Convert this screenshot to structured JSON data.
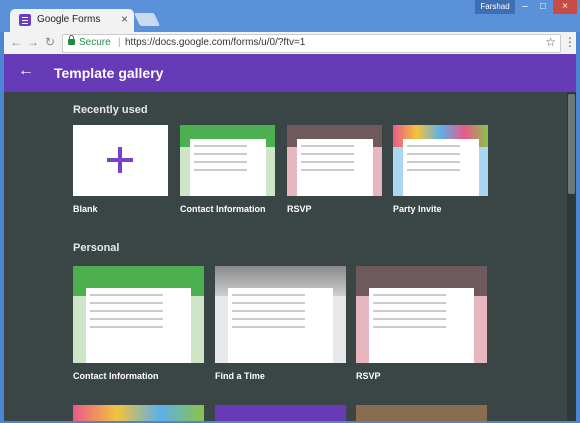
{
  "browser": {
    "tab_title": "Google Forms",
    "user": "Farshad",
    "secure_label": "Secure",
    "url": "https://docs.google.com/forms/u/0/?ftv=1"
  },
  "app": {
    "title": "Template gallery"
  },
  "sections": {
    "recent": "Recently used",
    "personal": "Personal"
  },
  "recent_cards": [
    "Blank",
    "Contact Information",
    "RSVP",
    "Party Invite"
  ],
  "personal_cards": [
    "Contact Information",
    "Find a Time",
    "RSVP"
  ],
  "colors": {
    "accent": "#673ab7",
    "green": "#4caf50",
    "pink": "#e6b7bf",
    "blue": "#a9d7f2"
  }
}
